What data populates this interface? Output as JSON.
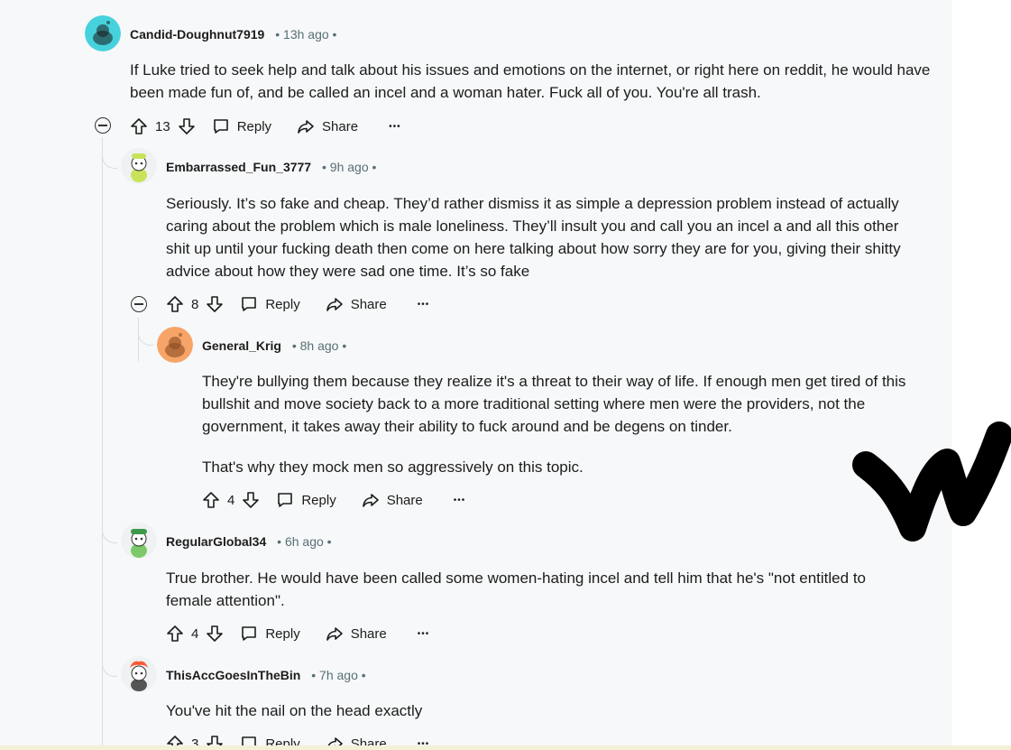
{
  "comments": [
    {
      "username": "Candid-Doughnut7919",
      "time": "13h ago",
      "body": [
        "If Luke tried to seek help and talk about his issues and emotions on the internet, or right here on reddit, he would have been made fun of, and be called an incel and a woman hater. Fuck all of you. You're all trash."
      ],
      "score": "13",
      "avatar_color": "#46d2dd"
    },
    {
      "username": "Embarrassed_Fun_3777",
      "time": "9h ago",
      "body": [
        "Seriously. It’s so fake and cheap. They’d rather dismiss it as simple a depression problem instead of actually caring about the problem which is male loneliness. They’ll insult you and call you an incel a and all this other shit up until your fucking death then come on here talking about how sorry they are for you, giving their shitty advice about how they were sad one time. It’s so fake"
      ],
      "score": "8",
      "avatar_color": "#c8e35a"
    },
    {
      "username": "General_Krig",
      "time": "8h ago",
      "body": [
        "They're bullying them because they realize it's a threat to their way of life. If enough men get tired of this bullshit and move society back to a more traditional setting where men were the providers, not the government, it takes away their ability to fuck around and be degens on tinder.",
        "That's why they mock men so aggressively on this topic."
      ],
      "score": "4",
      "avatar_color": "#f6a468"
    },
    {
      "username": "RegularGlobal34",
      "time": "6h ago",
      "body": [
        "True brother. He would have been called some women-hating incel and tell him that he's \"not entitled to female attention\"."
      ],
      "score": "4",
      "avatar_color": "#7bc96a"
    },
    {
      "username": "ThisAccGoesInTheBin",
      "time": "7h ago",
      "body": [
        "You've hit the nail on the head exactly"
      ],
      "score": "3",
      "avatar_color": "#ff5a36"
    }
  ],
  "labels": {
    "reply": "Reply",
    "share": "Share",
    "more": "•••",
    "separator": "•"
  },
  "colors": {
    "panel_bg": "#f7f8f9",
    "meta_gray": "#576f76",
    "thread_line": "#d8dde0"
  }
}
